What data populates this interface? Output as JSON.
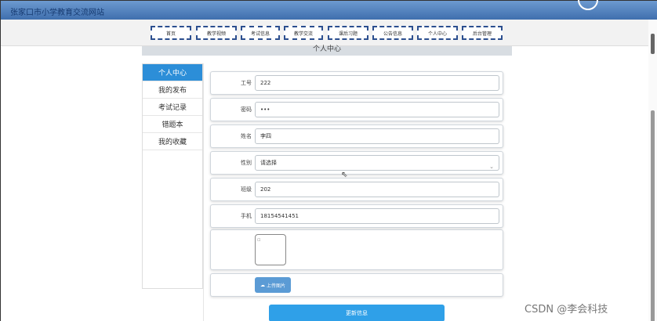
{
  "header": {
    "site_title": "张家口市小学教育交流网站"
  },
  "nav": [
    {
      "label": "首页"
    },
    {
      "label": "教学视频"
    },
    {
      "label": "考试信息"
    },
    {
      "label": "教学交流"
    },
    {
      "label": "课后习题"
    },
    {
      "label": "公告信息"
    },
    {
      "label": "个人中心"
    },
    {
      "label": "后台管理"
    }
  ],
  "section_title": "个人中心",
  "sidebar": [
    {
      "label": "个人中心",
      "active": true
    },
    {
      "label": "我的发布"
    },
    {
      "label": "考试记录"
    },
    {
      "label": "错题本"
    },
    {
      "label": "我的收藏"
    }
  ],
  "form": {
    "work_id": {
      "label": "工号",
      "value": "222"
    },
    "password": {
      "label": "密码",
      "value": "•••"
    },
    "name": {
      "label": "姓名",
      "value": "李四"
    },
    "gender": {
      "label": "性别",
      "value": "请选择"
    },
    "class": {
      "label": "班级",
      "value": "202"
    },
    "phone": {
      "label": "手机",
      "value": "18154541451"
    }
  },
  "upload_label": "上传图片",
  "update_label": "更新信息",
  "watermark": "CSDN @李会科技",
  "colors": {
    "topbar": "#3f6fae",
    "active": "#2c8ed8",
    "button": "#2fa0e8"
  }
}
